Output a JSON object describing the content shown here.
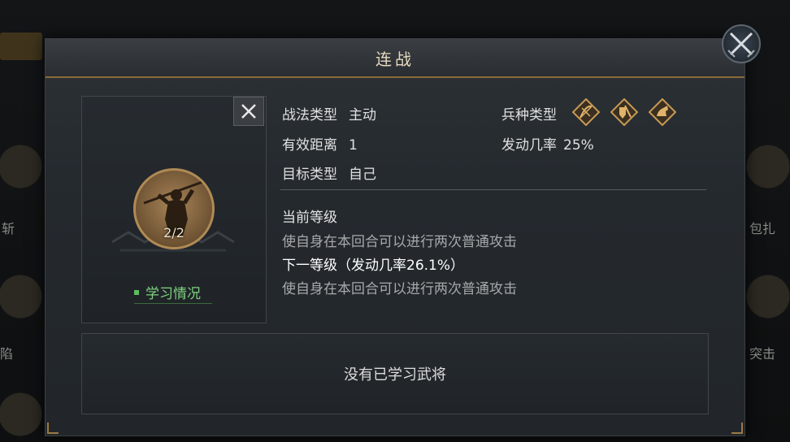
{
  "background": {
    "left_labels": [
      "斩",
      "陷"
    ],
    "right_labels": [
      "包扎",
      "突击"
    ]
  },
  "dialog": {
    "title": "连战"
  },
  "skill": {
    "level_display": "2/2",
    "learn_status_label": "学习情况",
    "portrait_icon": "warrior-spear-icon"
  },
  "info": {
    "tactic_type_label": "战法类型",
    "tactic_type_value": "主动",
    "range_label": "有效距离",
    "range_value": "1",
    "target_label": "目标类型",
    "target_value": "自己",
    "troop_type_label": "兵种类型",
    "trigger_rate_label": "发动几率",
    "trigger_rate_value": "25%"
  },
  "troop_types": [
    "archer-icon",
    "infantry-shield-icon",
    "cavalry-icon"
  ],
  "levels": {
    "current_label": "当前等级",
    "current_desc": "使自身在本回合可以进行两次普通攻击",
    "next_label": "下一等级（发动几率26.1%）",
    "next_desc": "使自身在本回合可以进行两次普通攻击"
  },
  "generals": {
    "empty_text": "没有已学习武将"
  },
  "colors": {
    "accent_gold": "#b08a55",
    "learn_green": "#7fd07f"
  }
}
